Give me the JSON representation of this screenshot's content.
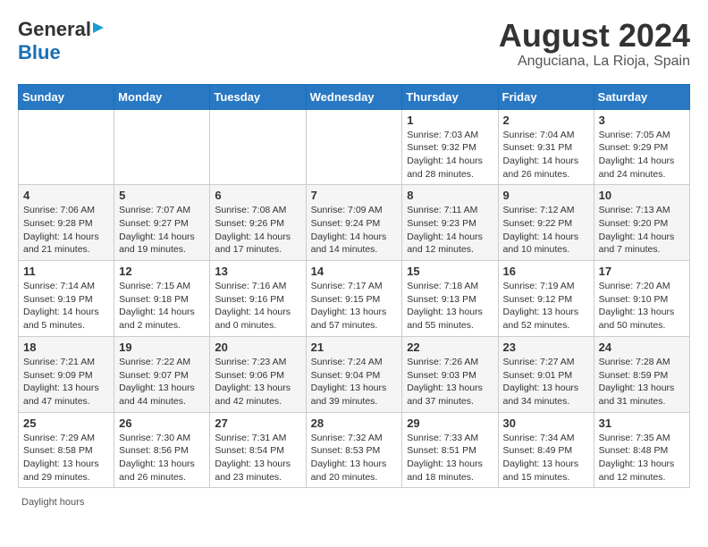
{
  "header": {
    "logo_general": "General",
    "logo_blue": "Blue",
    "month_title": "August 2024",
    "location": "Anguciana, La Rioja, Spain"
  },
  "days_of_week": [
    "Sunday",
    "Monday",
    "Tuesday",
    "Wednesday",
    "Thursday",
    "Friday",
    "Saturday"
  ],
  "weeks": [
    [
      {
        "day": "",
        "info": ""
      },
      {
        "day": "",
        "info": ""
      },
      {
        "day": "",
        "info": ""
      },
      {
        "day": "",
        "info": ""
      },
      {
        "day": "1",
        "info": "Sunrise: 7:03 AM\nSunset: 9:32 PM\nDaylight: 14 hours and 28 minutes."
      },
      {
        "day": "2",
        "info": "Sunrise: 7:04 AM\nSunset: 9:31 PM\nDaylight: 14 hours and 26 minutes."
      },
      {
        "day": "3",
        "info": "Sunrise: 7:05 AM\nSunset: 9:29 PM\nDaylight: 14 hours and 24 minutes."
      }
    ],
    [
      {
        "day": "4",
        "info": "Sunrise: 7:06 AM\nSunset: 9:28 PM\nDaylight: 14 hours and 21 minutes."
      },
      {
        "day": "5",
        "info": "Sunrise: 7:07 AM\nSunset: 9:27 PM\nDaylight: 14 hours and 19 minutes."
      },
      {
        "day": "6",
        "info": "Sunrise: 7:08 AM\nSunset: 9:26 PM\nDaylight: 14 hours and 17 minutes."
      },
      {
        "day": "7",
        "info": "Sunrise: 7:09 AM\nSunset: 9:24 PM\nDaylight: 14 hours and 14 minutes."
      },
      {
        "day": "8",
        "info": "Sunrise: 7:11 AM\nSunset: 9:23 PM\nDaylight: 14 hours and 12 minutes."
      },
      {
        "day": "9",
        "info": "Sunrise: 7:12 AM\nSunset: 9:22 PM\nDaylight: 14 hours and 10 minutes."
      },
      {
        "day": "10",
        "info": "Sunrise: 7:13 AM\nSunset: 9:20 PM\nDaylight: 14 hours and 7 minutes."
      }
    ],
    [
      {
        "day": "11",
        "info": "Sunrise: 7:14 AM\nSunset: 9:19 PM\nDaylight: 14 hours and 5 minutes."
      },
      {
        "day": "12",
        "info": "Sunrise: 7:15 AM\nSunset: 9:18 PM\nDaylight: 14 hours and 2 minutes."
      },
      {
        "day": "13",
        "info": "Sunrise: 7:16 AM\nSunset: 9:16 PM\nDaylight: 14 hours and 0 minutes."
      },
      {
        "day": "14",
        "info": "Sunrise: 7:17 AM\nSunset: 9:15 PM\nDaylight: 13 hours and 57 minutes."
      },
      {
        "day": "15",
        "info": "Sunrise: 7:18 AM\nSunset: 9:13 PM\nDaylight: 13 hours and 55 minutes."
      },
      {
        "day": "16",
        "info": "Sunrise: 7:19 AM\nSunset: 9:12 PM\nDaylight: 13 hours and 52 minutes."
      },
      {
        "day": "17",
        "info": "Sunrise: 7:20 AM\nSunset: 9:10 PM\nDaylight: 13 hours and 50 minutes."
      }
    ],
    [
      {
        "day": "18",
        "info": "Sunrise: 7:21 AM\nSunset: 9:09 PM\nDaylight: 13 hours and 47 minutes."
      },
      {
        "day": "19",
        "info": "Sunrise: 7:22 AM\nSunset: 9:07 PM\nDaylight: 13 hours and 44 minutes."
      },
      {
        "day": "20",
        "info": "Sunrise: 7:23 AM\nSunset: 9:06 PM\nDaylight: 13 hours and 42 minutes."
      },
      {
        "day": "21",
        "info": "Sunrise: 7:24 AM\nSunset: 9:04 PM\nDaylight: 13 hours and 39 minutes."
      },
      {
        "day": "22",
        "info": "Sunrise: 7:26 AM\nSunset: 9:03 PM\nDaylight: 13 hours and 37 minutes."
      },
      {
        "day": "23",
        "info": "Sunrise: 7:27 AM\nSunset: 9:01 PM\nDaylight: 13 hours and 34 minutes."
      },
      {
        "day": "24",
        "info": "Sunrise: 7:28 AM\nSunset: 8:59 PM\nDaylight: 13 hours and 31 minutes."
      }
    ],
    [
      {
        "day": "25",
        "info": "Sunrise: 7:29 AM\nSunset: 8:58 PM\nDaylight: 13 hours and 29 minutes."
      },
      {
        "day": "26",
        "info": "Sunrise: 7:30 AM\nSunset: 8:56 PM\nDaylight: 13 hours and 26 minutes."
      },
      {
        "day": "27",
        "info": "Sunrise: 7:31 AM\nSunset: 8:54 PM\nDaylight: 13 hours and 23 minutes."
      },
      {
        "day": "28",
        "info": "Sunrise: 7:32 AM\nSunset: 8:53 PM\nDaylight: 13 hours and 20 minutes."
      },
      {
        "day": "29",
        "info": "Sunrise: 7:33 AM\nSunset: 8:51 PM\nDaylight: 13 hours and 18 minutes."
      },
      {
        "day": "30",
        "info": "Sunrise: 7:34 AM\nSunset: 8:49 PM\nDaylight: 13 hours and 15 minutes."
      },
      {
        "day": "31",
        "info": "Sunrise: 7:35 AM\nSunset: 8:48 PM\nDaylight: 13 hours and 12 minutes."
      }
    ]
  ],
  "daylight_note": "Daylight hours"
}
